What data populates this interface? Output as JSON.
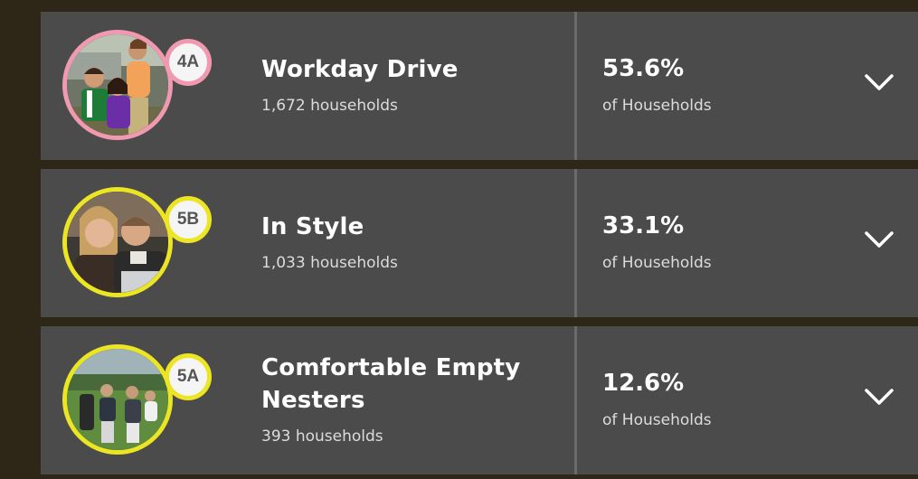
{
  "segments": [
    {
      "code": "4A",
      "name": "Workday Drive",
      "households": "1,672 households",
      "percent": "53.6%",
      "percent_label": "of Households",
      "ring_color": "#f199b0",
      "photo_icon": "family-photo-icon"
    },
    {
      "code": "5B",
      "name": "In Style",
      "households": "1,033 households",
      "percent": "33.1%",
      "percent_label": "of Households",
      "ring_color": "#ece524",
      "photo_icon": "couple-photo-icon"
    },
    {
      "code": "5A",
      "name": "Comfortable Empty Nesters",
      "households": "393 households",
      "percent": "12.6%",
      "percent_label": "of Households",
      "ring_color": "#ece524",
      "photo_icon": "golfers-photo-icon"
    }
  ],
  "colors": {
    "background": "#2e2616",
    "card": "#4b4b4b",
    "divider": "#6b6b6b",
    "pink": "#f199b0",
    "yellow": "#ece524"
  },
  "icons": {
    "expand": "chevron-down-icon"
  }
}
